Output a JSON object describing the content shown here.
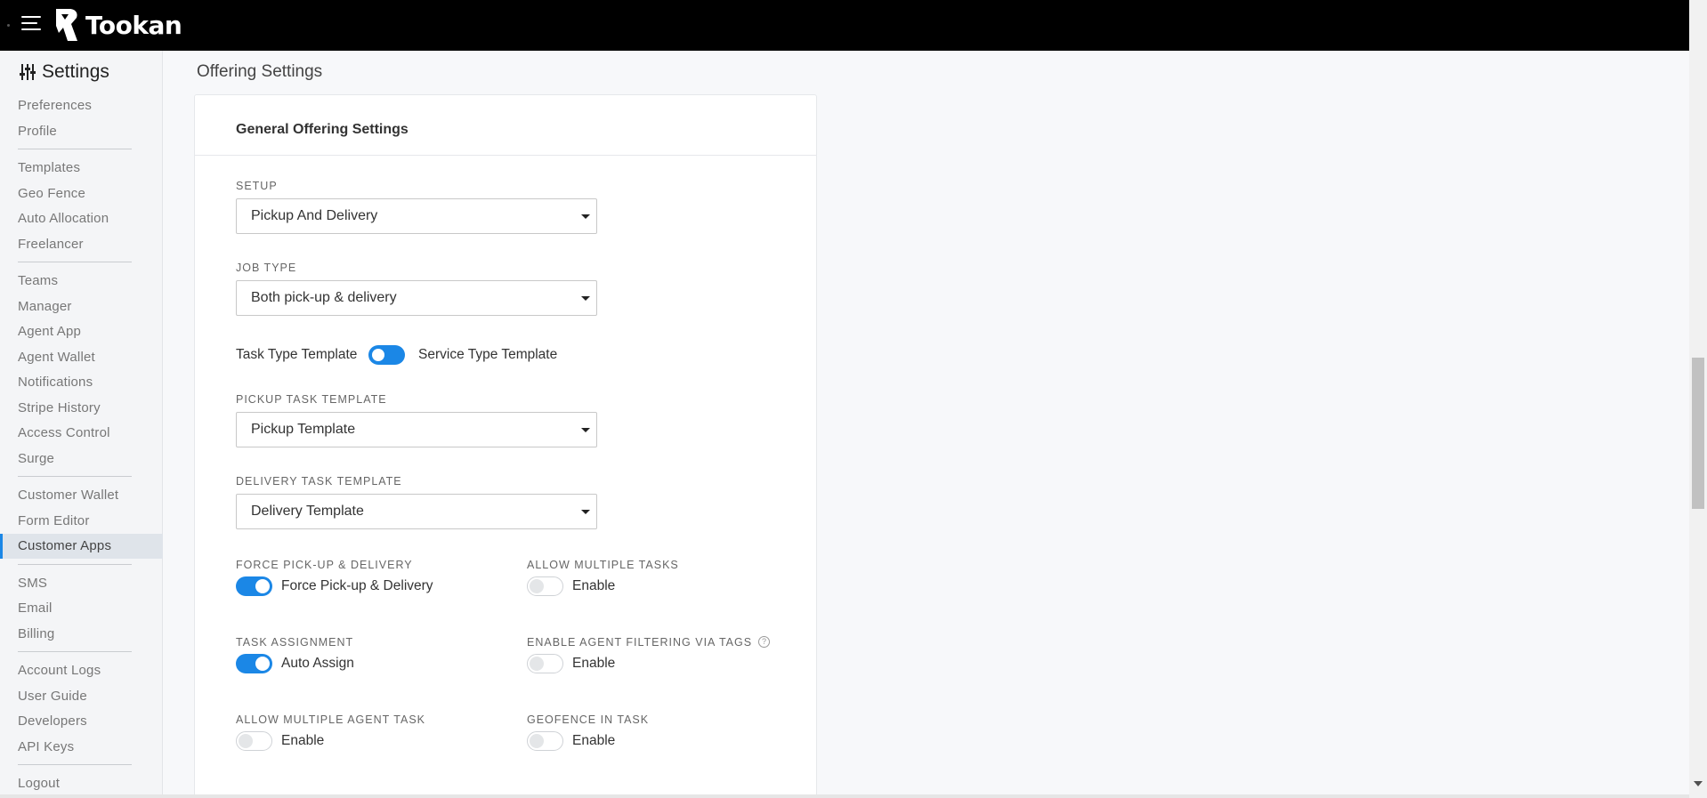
{
  "app": {
    "name": "Tookan"
  },
  "sidebar": {
    "title": "Settings",
    "groups": [
      [
        "Preferences",
        "Profile"
      ],
      [
        "Templates",
        "Geo Fence",
        "Auto Allocation",
        "Freelancer"
      ],
      [
        "Teams",
        "Manager",
        "Agent App",
        "Agent Wallet",
        "Notifications",
        "Stripe History",
        "Access Control",
        "Surge"
      ],
      [
        "Customer Wallet",
        "Form Editor",
        "Customer Apps"
      ],
      [
        "SMS",
        "Email",
        "Billing"
      ],
      [
        "Account Logs",
        "User Guide",
        "Developers",
        "API Keys"
      ],
      [
        "Logout"
      ]
    ],
    "active": "Customer Apps"
  },
  "main": {
    "page_title": "Offering Settings",
    "card_title": "General Offering Settings",
    "setup": {
      "label": "SETUP",
      "value": "Pickup And Delivery"
    },
    "job_type": {
      "label": "JOB TYPE",
      "value": "Both pick-up & delivery"
    },
    "template_switch": {
      "left": "Task Type Template",
      "right": "Service Type Template"
    },
    "pickup_template": {
      "label": "PICKUP TASK TEMPLATE",
      "value": "Pickup Template"
    },
    "delivery_template": {
      "label": "DELIVERY TASK TEMPLATE",
      "value": "Delivery Template"
    },
    "force_pickup": {
      "label": "FORCE PICK-UP & DELIVERY",
      "text": "Force Pick-up & Delivery",
      "on": true
    },
    "allow_multiple_tasks": {
      "label": "ALLOW MULTIPLE TASKS",
      "text": "Enable",
      "on": false
    },
    "task_assignment": {
      "label": "TASK ASSIGNMENT",
      "text": "Auto Assign",
      "on": true
    },
    "agent_filtering": {
      "label": "ENABLE AGENT FILTERING VIA TAGS",
      "text": "Enable",
      "on": false
    },
    "multiple_agent_task": {
      "label": "ALLOW MULTIPLE AGENT TASK",
      "text": "Enable",
      "on": false
    },
    "geofence_in_task": {
      "label": "GEOFENCE IN TASK",
      "text": "Enable",
      "on": false
    }
  },
  "colors": {
    "accent": "#1b87e6",
    "topbar": "#000000"
  }
}
